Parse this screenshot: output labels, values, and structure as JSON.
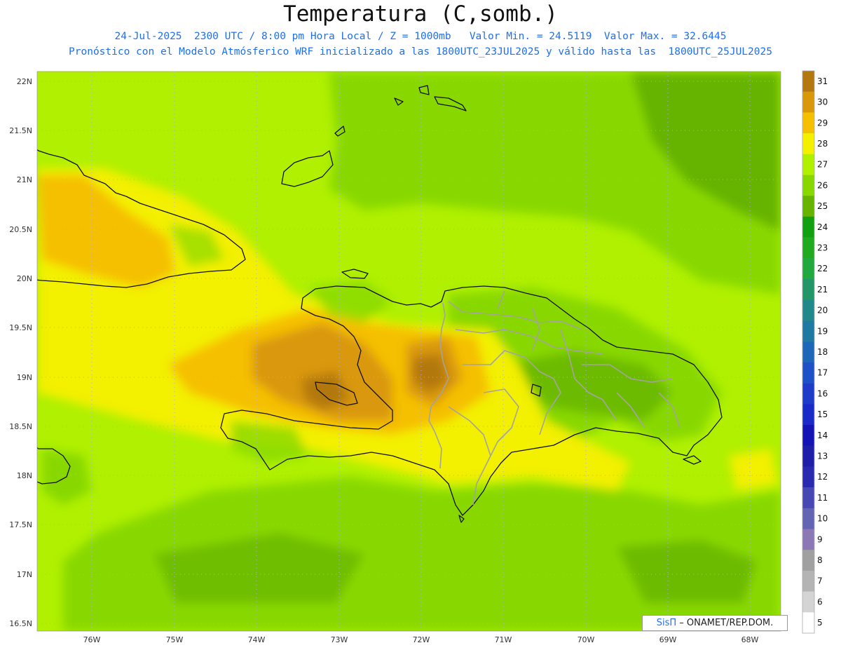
{
  "header": {
    "title": "Temperatura (C,somb.)",
    "line1": "24-Jul-2025  2300 UTC / 8:00 pm Hora Local / Z = 1000mb   Valor Min. = 24.5119  Valor Max. = 32.6445",
    "line2": "Pronóstico con el Modelo Atmósferico WRF inicializado a las 1800UTC_23JUL2025 y válido hasta las  1800UTC_25JUL2025"
  },
  "map": {
    "lat_labels": [
      "22N",
      "21.5N",
      "21N",
      "20.5N",
      "20N",
      "19.5N",
      "19N",
      "18.5N",
      "18N",
      "17.5N",
      "17N",
      "16.5N"
    ],
    "lon_labels": [
      "76W",
      "75W",
      "74W",
      "73W",
      "72W",
      "71W",
      "70W",
      "69W",
      "68W"
    ],
    "regions": [
      "Haiti",
      "Dominican Republic",
      "Cuba (east)",
      "Turks and Caicos",
      "Inagua",
      "Jamaica (east)"
    ]
  },
  "colorbar": {
    "labels": [
      "31",
      "30",
      "29",
      "28",
      "27",
      "26",
      "25",
      "24",
      "23",
      "22",
      "21",
      "20",
      "19",
      "18",
      "17",
      "16",
      "15",
      "14",
      "13",
      "12",
      "11",
      "10",
      "9",
      "8",
      "7",
      "6",
      "5"
    ],
    "colors": [
      "#b3780f",
      "#d9980a",
      "#f5c000",
      "#f3f000",
      "#b0f000",
      "#88d800",
      "#66b400",
      "#10a010",
      "#20aa20",
      "#21a940",
      "#229668",
      "#21898a",
      "#1e7aa0",
      "#1e66b8",
      "#1e50c8",
      "#1e3cc8",
      "#1a2ac8",
      "#1414b4",
      "#1e1ea8",
      "#2a2ab0",
      "#4848b4",
      "#6464b4",
      "#8c78b4",
      "#a0a0a0",
      "#b4b4b4",
      "#d4d4d4",
      "#ffffff"
    ]
  },
  "credit": {
    "logo": "SisΠ",
    "text": " – ONAMET/REP.DOM."
  }
}
